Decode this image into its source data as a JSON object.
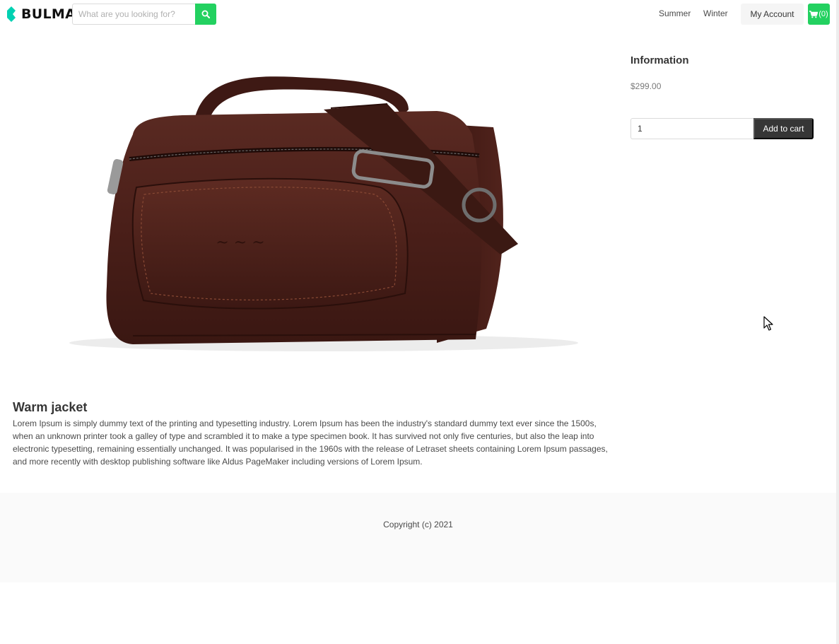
{
  "navbar": {
    "brand_name": "BULMA",
    "brand_color": "#00d1b2",
    "search": {
      "placeholder": "What are you looking for?",
      "value": "",
      "button_icon": "search-icon",
      "button_color": "#23d160"
    },
    "links": [
      "Summer",
      "Winter"
    ],
    "account_label": "My Account",
    "cart": {
      "icon": "cart-icon",
      "count_label": "(0)",
      "color": "#23d160"
    }
  },
  "product": {
    "image_subject": "brown leather handbag",
    "name": "Warm jacket",
    "description": "Lorem Ipsum is simply dummy text of the printing and typesetting industry. Lorem Ipsum has been the industry's standard dummy text ever since the 1500s, when an unknown printer took a galley of type and scrambled it to make a type specimen book. It has survived not only five centuries, but also the leap into electronic typesetting, remaining essentially unchanged. It was popularised in the 1960s with the release of Letraset sheets containing Lorem Ipsum passages, and more recently with desktop publishing software like Aldus PageMaker including versions of Lorem Ipsum."
  },
  "info_panel": {
    "title": "Information",
    "price": "$299.00",
    "quantity_value": "1",
    "add_to_cart_label": "Add to cart",
    "add_to_cart_color": "#363636"
  },
  "footer": {
    "copyright": "Copyright (c) 2021"
  }
}
